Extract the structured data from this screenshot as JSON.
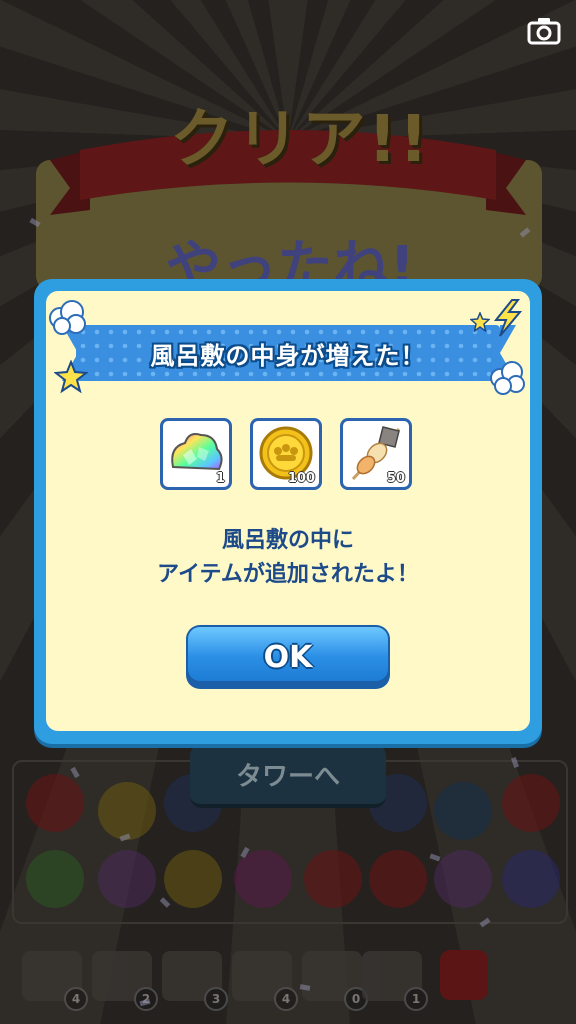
{
  "background": {
    "banner_text": "クリア!!",
    "subtitle_text": "やったね!",
    "tower_button_label": "タワーへ",
    "slot_counts": [
      "4",
      "2",
      "3",
      "4",
      "0",
      "1"
    ]
  },
  "modal": {
    "title": "風呂敷の中身が増えた！",
    "items": [
      {
        "icon": "rainbow-crystal-icon",
        "count": "1"
      },
      {
        "icon": "gold-coin-icon",
        "count": "100"
      },
      {
        "icon": "oden-skewer-icon",
        "count": "50"
      }
    ],
    "message_line1": "風呂敷の中に",
    "message_line2": "アイテムが追加されたよ！",
    "ok_label": "OK"
  },
  "colors": {
    "modal_border": "#2e9ee0",
    "modal_bg": "#fff9c8",
    "ribbon": "#3a8fe0",
    "text_dark_blue": "#1d4b8a",
    "ok_button": "#2b8fe6"
  }
}
